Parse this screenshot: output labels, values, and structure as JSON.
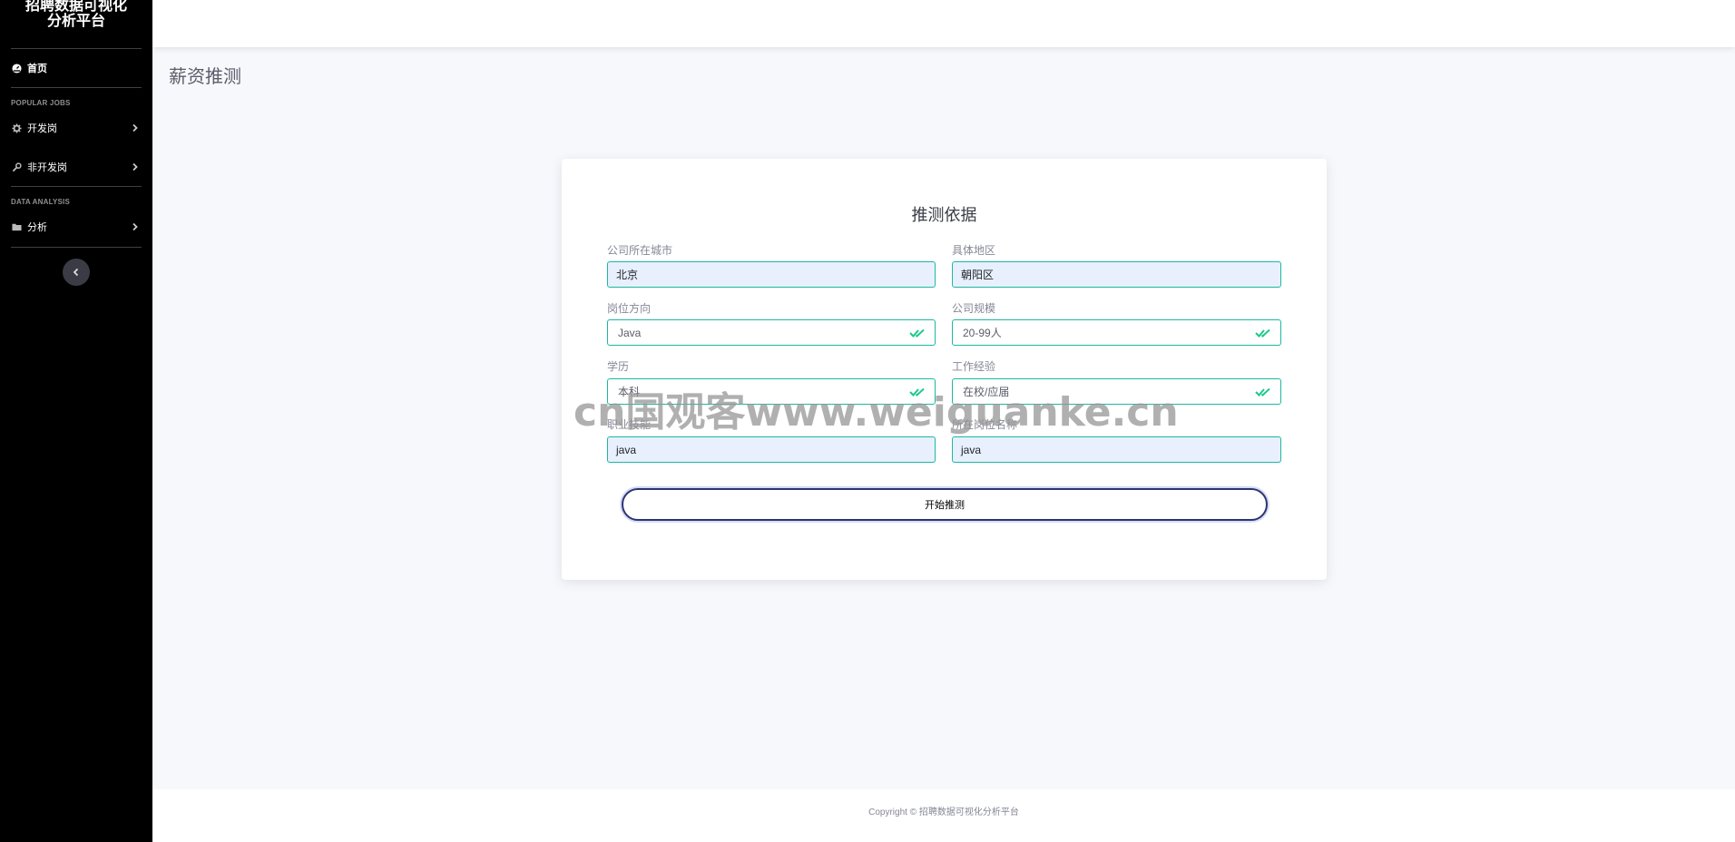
{
  "app": {
    "brand_line1": "招聘数据可视化",
    "brand_line2": "分析平台"
  },
  "sidebar": {
    "home_label": "首页",
    "section1_heading": "POPULAR JOBS",
    "dev_label": "开发岗",
    "nondev_label": "非开发岗",
    "section2_heading": "DATA ANALYSIS",
    "analysis_label": "分析",
    "icons": {
      "home": "tachometer-icon",
      "dev": "gear-icon",
      "nondev": "wrench-icon",
      "analysis": "folder-icon",
      "toggle": "chevron-left-icon"
    }
  },
  "page": {
    "title": "薪资推测"
  },
  "form": {
    "title": "推测依据",
    "city_label": "公司所在城市",
    "city_value": "北京",
    "district_label": "具体地区",
    "district_value": "朝阳区",
    "direction_label": "岗位方向",
    "direction_value": "Java",
    "scale_label": "公司规模",
    "scale_value": "20-99人",
    "education_label": "学历",
    "education_value": "本科",
    "experience_label": "工作经验",
    "experience_value": "在校/应届",
    "skill_label": "职业技能",
    "skill_value": "java",
    "job_name_label": "所在岗位名称",
    "job_name_value": "java",
    "submit_label": "开始推测"
  },
  "watermark": "cn国观客www.weiguanke.cn",
  "footer": {
    "copyright": "Copyright © 招聘数据可视化分析平台"
  },
  "colors": {
    "sidebar_bg": "#000000",
    "field_border": "#1cb8a0",
    "check": "#1cc88a",
    "filled_bg": "#e8f0fe"
  }
}
